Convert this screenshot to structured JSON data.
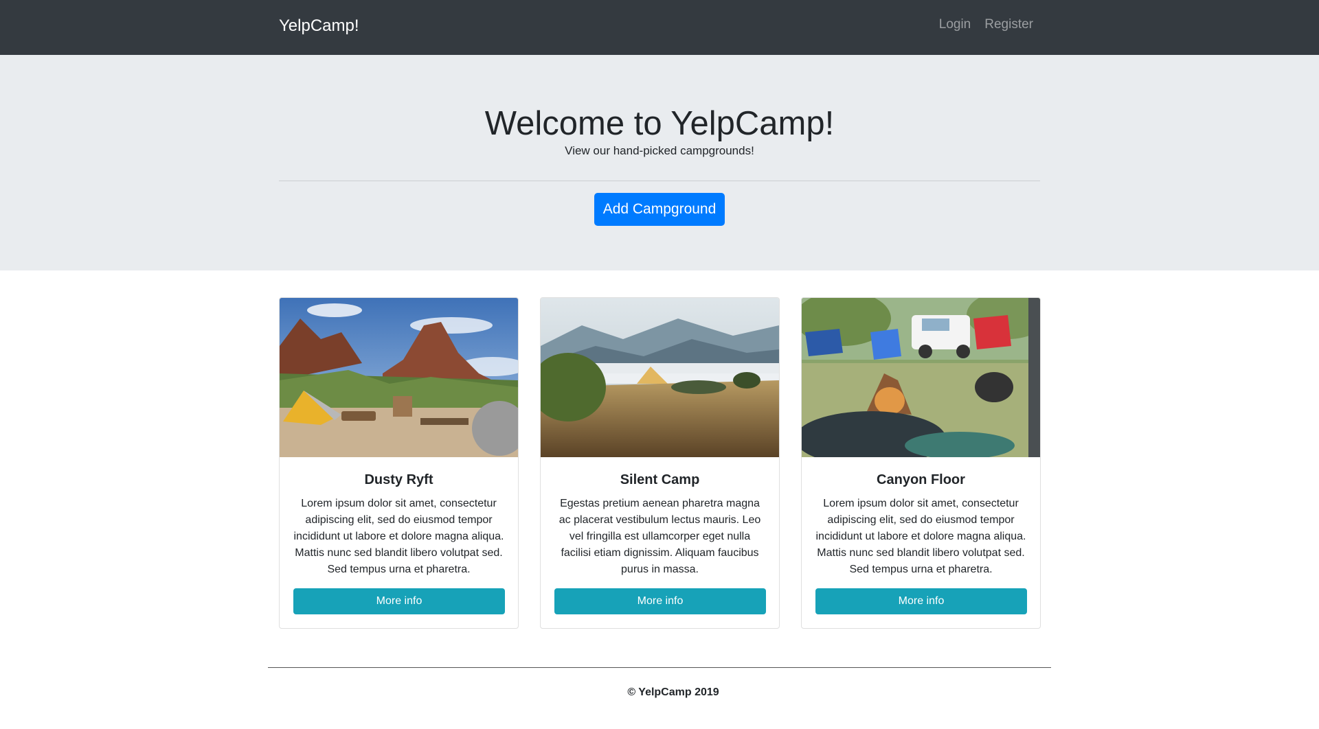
{
  "navbar": {
    "brand": "YelpCamp!",
    "links": [
      "Login",
      "Register"
    ]
  },
  "jumbotron": {
    "title": "Welcome to YelpCamp!",
    "lead": "View our hand-picked campgrounds!",
    "button": "Add Campground"
  },
  "campgrounds": [
    {
      "name": "Dusty Ryft",
      "image": "mountain-campsite-tent-image",
      "description": "Lorem ipsum dolor sit amet, consectetur adipiscing elit, sed do eiusmod tempor incididunt ut labore et dolore magna aliqua. Mattis nunc sed blandit libero volutpat sed. Sed tempus urna et pharetra.",
      "button": "More info"
    },
    {
      "name": "Silent Camp",
      "image": "foggy-mountain-tent-image",
      "description": "Egestas pretium aenean pharetra magna ac placerat vestibulum lectus mauris. Leo vel fringilla est ullamcorper eget nulla facilisi etiam dignissim. Aliquam faucibus purus in massa.",
      "button": "More info"
    },
    {
      "name": "Canyon Floor",
      "image": "campfire-chairs-truck-image",
      "description": "Lorem ipsum dolor sit amet, consectetur adipiscing elit, sed do eiusmod tempor incididunt ut labore et dolore magna aliqua. Mattis nunc sed blandit libero volutpat sed. Sed tempus urna et pharetra.",
      "button": "More info"
    }
  ],
  "footer": {
    "text": "© YelpCamp 2019"
  },
  "colors": {
    "navbar": "#343a40",
    "jumbotron": "#e9ecef",
    "primary": "#007bff",
    "info": "#17a2b8"
  }
}
